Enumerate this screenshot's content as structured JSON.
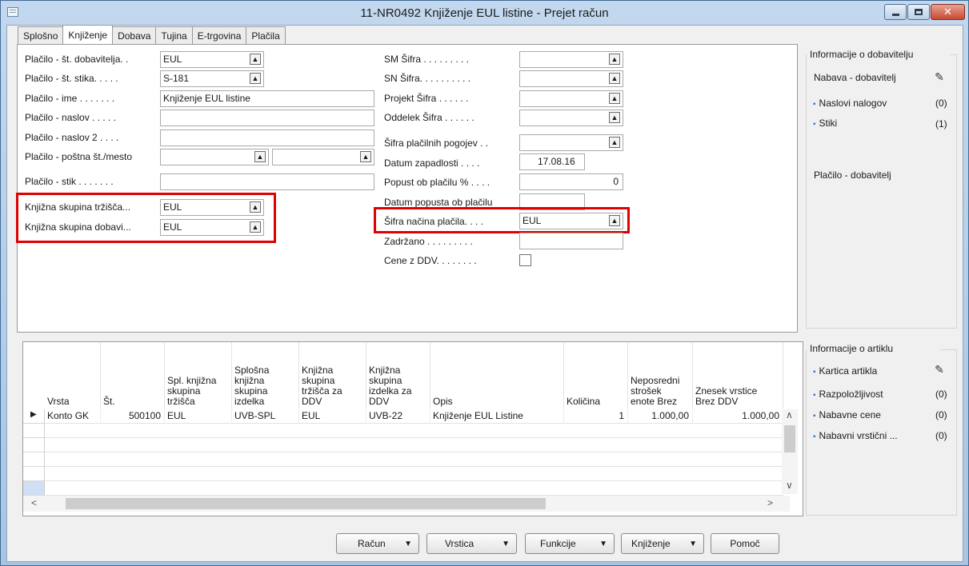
{
  "window": {
    "title": "11-NR0492 Knjiženje EUL listine - Prejet račun"
  },
  "tabs": [
    {
      "label": "Splošno",
      "active": false
    },
    {
      "label": "Knjiženje",
      "active": true
    },
    {
      "label": "Dobava",
      "active": false
    },
    {
      "label": "Tujina",
      "active": false
    },
    {
      "label": "E-trgovina",
      "active": false
    },
    {
      "label": "Plačila",
      "active": false
    }
  ],
  "left_fields": [
    {
      "label": "Plačilo - št. dobavitelja. .",
      "value": "EUL"
    },
    {
      "label": "Plačilo - št. stika. . . . .",
      "value": "S-181"
    },
    {
      "label": "Plačilo - ime . . . . . . .",
      "value": "Knjiženje EUL listine"
    },
    {
      "label": "Plačilo - naslov . . . . .",
      "value": ""
    },
    {
      "label": "Plačilo - naslov 2 . . . .",
      "value": ""
    },
    {
      "label": "Plačilo - poštna št./mesto",
      "value": "",
      "value2": ""
    },
    {
      "label": "Plačilo - stik . . . . . . .",
      "value": ""
    },
    {
      "label": "Knjižna skupina tržišča...",
      "value": "EUL"
    },
    {
      "label": "Knjižna skupina dobavi...",
      "value": "EUL"
    }
  ],
  "right_fields": [
    {
      "label": "SM Šifra . . . . . . . . .",
      "value": ""
    },
    {
      "label": "SN Šifra. . . . . . . . . .",
      "value": ""
    },
    {
      "label": "Projekt Šifra . . . . . .",
      "value": ""
    },
    {
      "label": "Oddelek Šifra . . . . . .",
      "value": ""
    },
    {
      "label": "Šifra plačilnih pogojev . .",
      "value": ""
    },
    {
      "label": "Datum zapadlosti . . . .",
      "value": "17.08.16"
    },
    {
      "label": "Popust ob plačilu % . . . .",
      "value": "0"
    },
    {
      "label": "Datum popusta ob plačilu",
      "value": ""
    },
    {
      "label": "Šifra načina plačila. . . .",
      "value": "EUL"
    },
    {
      "label": "Zadržano . . . . . . . . .",
      "value": ""
    },
    {
      "label": "Cene z DDV. . . . . . . .",
      "value": ""
    }
  ],
  "grid": {
    "headers": [
      "Vrsta",
      "Št.",
      "Spl. knjižna\nskupina\ntržišča",
      "Splošna\nknjižna\nskupina\nizdelka",
      "Knjižna\nskupina\ntržišča za\nDDV",
      "Knjižna\nskupina\nizdelka za\nDDV",
      "Opis",
      "Količina",
      "Neposredni\nstrošek\nenote Brez",
      "Znesek vrstice\nBrez DDV"
    ],
    "rows": [
      [
        "Konto GK",
        "500100",
        "EUL",
        "UVB-SPL",
        "EUL",
        "UVB-22",
        "Knjiženje EUL Listine",
        "1",
        "1.000,00",
        "1.000,00"
      ]
    ]
  },
  "supplier_panel": {
    "title": "Informacije o dobavitelju",
    "header": "Nabava - dobavitelj",
    "items": [
      {
        "label": "Naslovi nalogov",
        "count": "(0)"
      },
      {
        "label": "Stiki",
        "count": "(1)"
      }
    ],
    "footer": "Plačilo - dobavitelj"
  },
  "item_panel": {
    "title": "Informacije o artiklu",
    "items": [
      {
        "label": "Kartica artikla",
        "count": ""
      },
      {
        "label": "Razpoložljivost",
        "count": "(0)"
      },
      {
        "label": "Nabavne cene",
        "count": "(0)"
      },
      {
        "label": "Nabavni vrstični ...",
        "count": "(0)"
      }
    ]
  },
  "buttons": {
    "racun": "Račun",
    "vrstica": "Vrstica",
    "funkcije": "Funkcije",
    "knjizenje": "Knjiženje",
    "pomoc": "Pomoč"
  },
  "colors": {
    "highlight_border": "#e00000",
    "link_bullet": "#3a77c8"
  }
}
